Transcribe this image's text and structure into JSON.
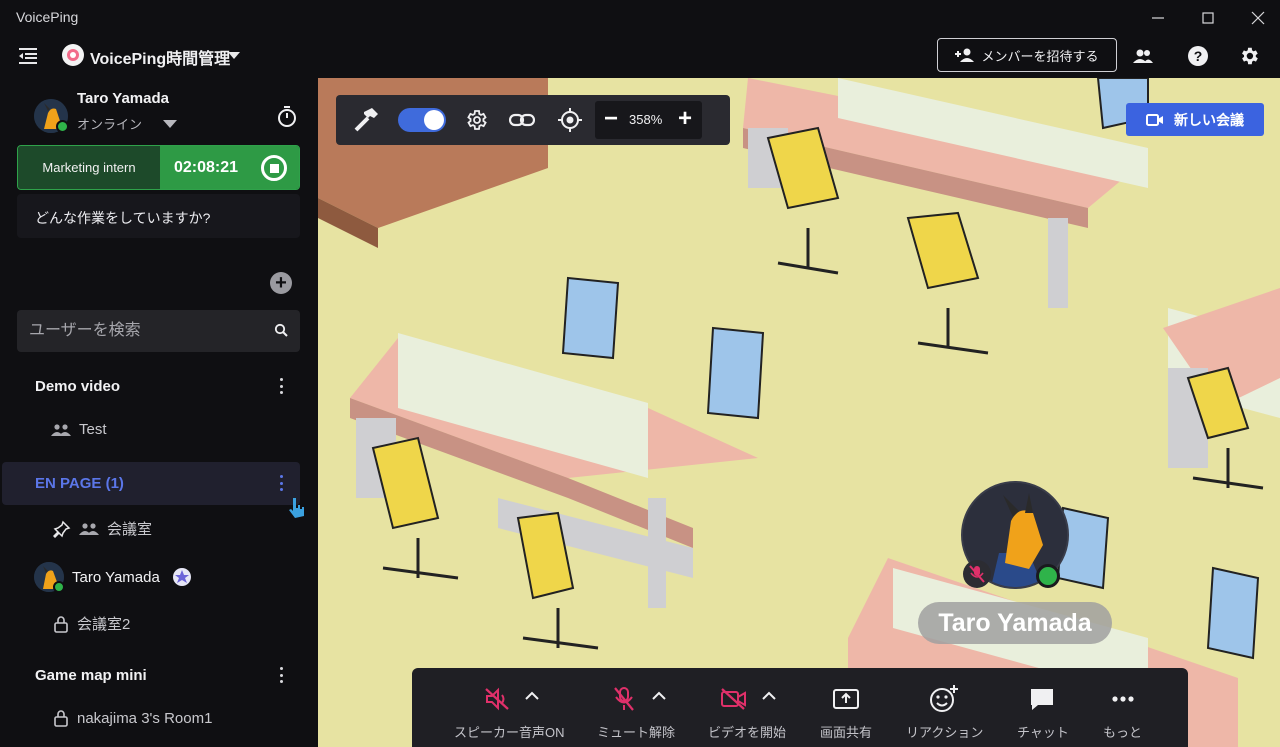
{
  "window": {
    "title": "VoicePing"
  },
  "header": {
    "workspace_name": "VoicePing時間管理",
    "invite_label": "メンバーを招待する"
  },
  "user": {
    "name": "Taro Yamada",
    "status": "オンライン"
  },
  "task": {
    "label": "Marketing intern",
    "time": "02:08:21"
  },
  "work_prompt": "どんな作業をしていますか?",
  "search": {
    "placeholder": "ユーザーを検索"
  },
  "groups": [
    {
      "title": "Demo video",
      "rooms": [
        "Test"
      ]
    },
    {
      "title": "EN PAGE (1)",
      "rooms": [
        "会議室"
      ],
      "members": [
        "Taro Yamada"
      ],
      "extra_rooms": [
        "会議室2"
      ]
    },
    {
      "title": "Game map mini",
      "rooms": [
        "nakajima 3's Room1"
      ]
    }
  ],
  "map": {
    "zoom": "358%",
    "new_meeting_label": "新しい会議",
    "player_name": "Taro Yamada"
  },
  "bottom_bar": {
    "speaker": "スピーカー音声ON",
    "mute": "ミュート解除",
    "video": "ビデオを開始",
    "screen_share": "画面共有",
    "reaction": "リアクション",
    "chat": "チャット",
    "more": "もっと"
  },
  "colors": {
    "accent": "#3b63e0",
    "online": "#2fb34a",
    "timer_green": "#2e9a45",
    "muted_pink": "#e0306a",
    "floor": "#e7e3a2"
  }
}
